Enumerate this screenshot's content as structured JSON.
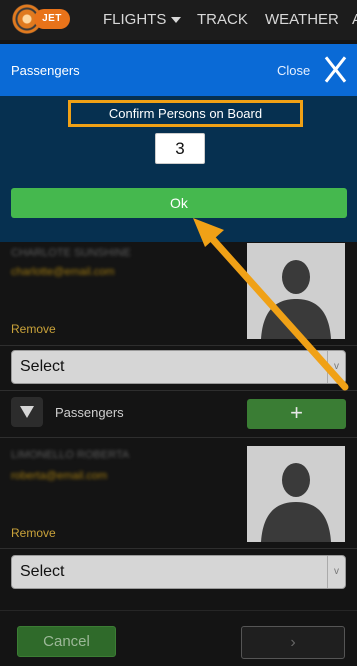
{
  "nav": {
    "logo_text": "JET",
    "items": [
      {
        "label": "FLIGHTS",
        "has_dropdown": true
      },
      {
        "label": "TRACK"
      },
      {
        "label": "WEATHER"
      },
      {
        "label": "A"
      }
    ]
  },
  "modal": {
    "title": "Passengers",
    "close_label": "Close",
    "close_icon": "close-x-icon",
    "confirm_label": "Confirm Persons on Board",
    "persons_count": "3",
    "ok_label": "Ok"
  },
  "background": {
    "passenger1": {
      "name": "CHARLOTE SUNSHINE",
      "email": "charlotte@email.com",
      "remove_label": "Remove",
      "select_value": "Select"
    },
    "section": {
      "label": "Passengers",
      "add_label": "+"
    },
    "passenger2": {
      "name": "LIMONELLO ROBERTA",
      "email": "roberta@email.com",
      "remove_label": "Remove",
      "select_value": "Select"
    }
  },
  "footer": {
    "cancel_label": "Cancel",
    "next_label": "›"
  },
  "colors": {
    "modal_header": "#0a6ad6",
    "modal_body": "#063050",
    "ok_button": "#45b84e",
    "highlight": "#f0a116",
    "annotation_arrow": "#f0a116"
  }
}
